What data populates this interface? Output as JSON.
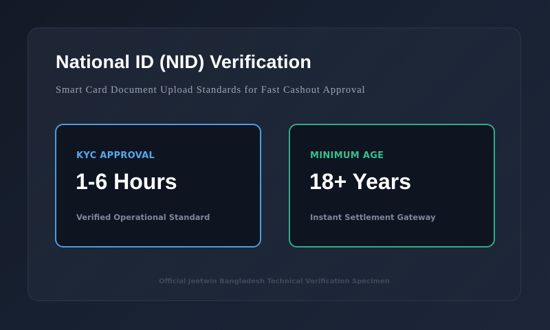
{
  "header": {
    "title": "National ID (NID) Verification",
    "subtitle": "Smart Card Document Upload Standards for Fast Cashout Approval"
  },
  "cards": [
    {
      "label": "KYC APPROVAL",
      "value": "1-6 Hours",
      "note": "Verified Operational Standard",
      "accent": "#4a9fdf"
    },
    {
      "label": "MINIMUM AGE",
      "value": "18+ Years",
      "note": "Instant Settlement Gateway",
      "accent": "#2fae86"
    }
  ],
  "footer": {
    "text": "Official Jeetwin Bangladesh Technical Verification Specimen"
  }
}
